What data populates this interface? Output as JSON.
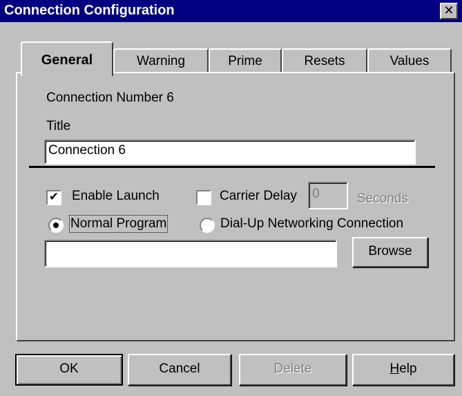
{
  "window": {
    "title": "Connection Configuration",
    "close_glyph": "✕"
  },
  "tabs": [
    {
      "label": "General",
      "active": true
    },
    {
      "label": "Warning",
      "active": false
    },
    {
      "label": "Prime",
      "active": false
    },
    {
      "label": "Resets",
      "active": false
    },
    {
      "label": "Values",
      "active": false
    }
  ],
  "general": {
    "connection_number": "Connection Number 6",
    "title_label": "Title",
    "title_value": "Connection 6",
    "enable_launch": {
      "label": "Enable Launch",
      "checked": true,
      "check_glyph": "✔"
    },
    "carrier_delay": {
      "label": "Carrier Delay",
      "checked": false,
      "value": "0",
      "unit": "Seconds"
    },
    "launch_type": {
      "normal_program": {
        "label": "Normal Program",
        "selected": true
      },
      "dial_up": {
        "label": "Dial-Up Networking Connection",
        "selected": false
      }
    },
    "program_path": "",
    "browse_label": "Browse"
  },
  "buttons": {
    "ok": "OK",
    "cancel": "Cancel",
    "delete": "Delete",
    "help": "Help"
  }
}
